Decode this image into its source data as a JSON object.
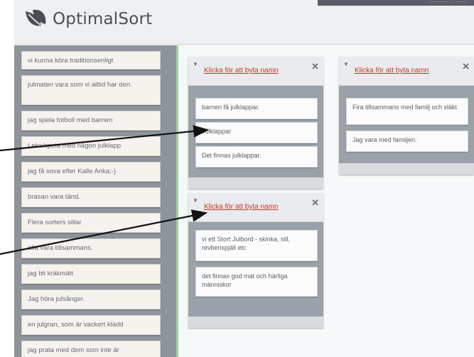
{
  "app": {
    "name": "OptimalSort",
    "top_right_text": "·· ······· ·· ·····"
  },
  "cards": [
    "vi kunna köra traditionsenligt",
    "julmaten vara som vi alltid har den.",
    "jag spela fotboll med barnen",
    "Leka/spela med någon julklapp",
    "jag få sova efter Kalle Anka;-)",
    "brasan vara tänd.",
    "Flera sorters sillar",
    "alla vara tillsammans.",
    "jag bli kräkmätt",
    "Jag höra julsånger.",
    "en julgran, som är vackert klädd",
    "jag prata med dem som inte är"
  ],
  "groups": [
    {
      "name": "Klicka för att byta namn",
      "cards": [
        "barnen få julklappar.",
        "Julklappar",
        "Det finnas julklappar."
      ]
    },
    {
      "name": "Klicka för att byta namn",
      "cards": [
        "Fira tillsammans med familj och släkt",
        "Jag vara med familjen."
      ]
    },
    {
      "name": "Klicka för att byta namn",
      "cards": [
        "vi ett Stort Julbord - skinka, sill, revbenspjäll etc",
        "det finnas god mat och härliga människor"
      ]
    }
  ],
  "icons": {
    "caret": "▼",
    "close": "✕"
  }
}
